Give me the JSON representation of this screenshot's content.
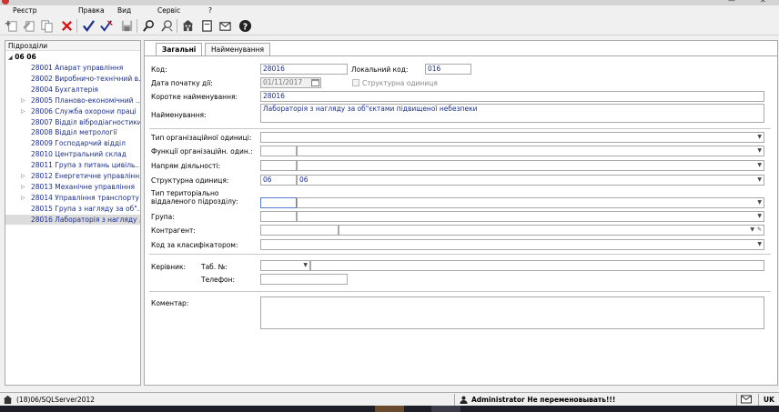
{
  "menu": [
    "Реєстр",
    "Правка",
    "Вид",
    "Сервіс",
    "?"
  ],
  "tree": {
    "header": "Підрозділи",
    "root": "06  06",
    "items": [
      {
        "label": "28001 Апарат управління",
        "expandable": false,
        "selected": false
      },
      {
        "label": "28002 Виробничо-технічний в...",
        "expandable": false,
        "selected": false
      },
      {
        "label": "28004 Бухгалтерія",
        "expandable": false,
        "selected": false
      },
      {
        "label": "28005 Планово-економічний ...",
        "expandable": true,
        "selected": false
      },
      {
        "label": "28006 Служба охорони праці",
        "expandable": true,
        "selected": false
      },
      {
        "label": "28007 Відділ вібродіагностики",
        "expandable": false,
        "selected": false
      },
      {
        "label": "28008 Відділ метрології",
        "expandable": false,
        "selected": false
      },
      {
        "label": "28009 Господарчий відділ",
        "expandable": false,
        "selected": false
      },
      {
        "label": "28010 Центральний склад",
        "expandable": false,
        "selected": false
      },
      {
        "label": "28011 Група з питань цивіль...",
        "expandable": false,
        "selected": false
      },
      {
        "label": "28012 Енергетичне управління",
        "expandable": true,
        "selected": false
      },
      {
        "label": "28013 Механічне управління",
        "expandable": true,
        "selected": false
      },
      {
        "label": "28014 Управління транспорту",
        "expandable": true,
        "selected": false
      },
      {
        "label": "28015 Група з нагляду за об\"...",
        "expandable": false,
        "selected": false
      },
      {
        "label": "28016 Лабораторія з нагляду ...",
        "expandable": false,
        "selected": true
      }
    ]
  },
  "tabs": [
    "Загальні",
    "Найменування"
  ],
  "form": {
    "code_label": "Код:",
    "code_value": "28016",
    "local_code_label": "Локальний код:",
    "local_code_value": "016",
    "start_date_label": "Дата початку дії:",
    "start_date_value": "01/11/2017",
    "structural_unit_check_label": "Структурна одиниця",
    "short_name_label": "Коротке найменування:",
    "short_name_value": "28016",
    "name_label": "Найменування:",
    "name_value": "Лабораторія з нагляду за об\"єктами підвищеної небезпеки",
    "org_unit_type_label": "Тип організаційної одиниці:",
    "org_unit_functions_label": "Функції організаційн. один.:",
    "activity_direction_label": "Напрям діяльності:",
    "structural_unit_label": "Структурна одиниця:",
    "structural_unit_code": "06",
    "structural_unit_name": "06",
    "remote_unit_type_label": "Тип територіально віддаленого підрозділу:",
    "group_label": "Група:",
    "counterparty_label": "Контрагент:",
    "classifier_code_label": "Код за класифікатором:",
    "head_label": "Керівник:",
    "tab_no_label": "Таб. №:",
    "phone_label": "Телефон:",
    "comment_label": "Коментар:"
  },
  "status": {
    "connection": "(18)06/SQLServer2012",
    "user_message": "Administrator Не переменовывать!!!",
    "lang": "UK"
  }
}
